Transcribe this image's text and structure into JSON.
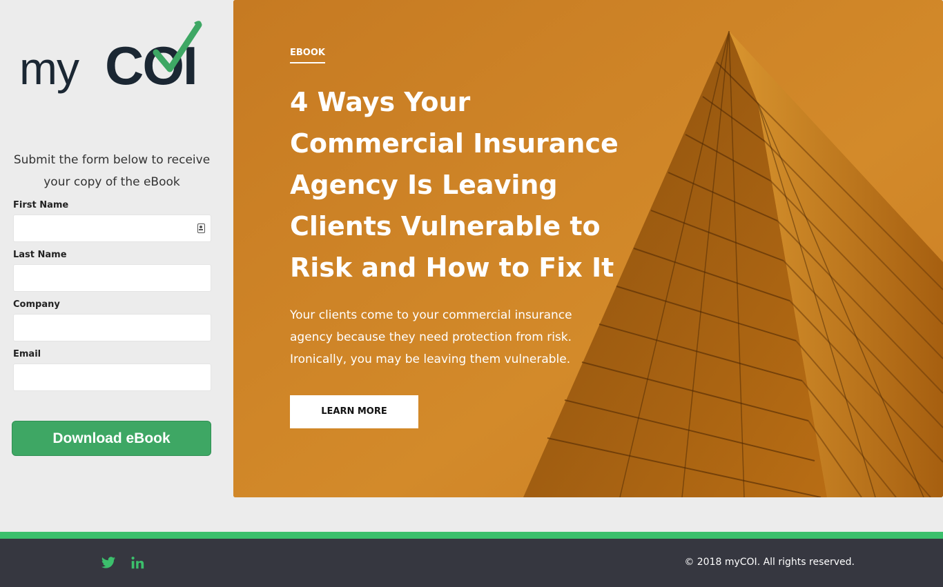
{
  "brand": {
    "logo_my": "my",
    "logo_coi": "COI",
    "colors": {
      "dark": "#1b2733",
      "check_green": "#3ea764"
    }
  },
  "form": {
    "intro": "Submit the form below to receive your copy of the eBook",
    "fields": [
      {
        "label": "First Name",
        "value": "",
        "icon": "contact-card-icon"
      },
      {
        "label": "Last Name",
        "value": ""
      },
      {
        "label": "Company",
        "value": ""
      },
      {
        "label": "Email",
        "value": ""
      }
    ],
    "submit_label": "Download eBook",
    "submit_color": "#3ea764"
  },
  "hero": {
    "eyebrow": "EBOOK",
    "title": "4 Ways Your Commercial Insurance Agency Is Leaving Clients Vulnerable to Risk and How to Fix It",
    "body": "Your clients come to your commercial insurance agency because they need protection from risk. Ironically, you may be leaving them vulnerable.",
    "cta_label": "LEARN MORE",
    "background_color": "#c87a1f"
  },
  "footer": {
    "social": [
      {
        "name": "twitter-icon"
      },
      {
        "name": "linkedin-icon"
      }
    ],
    "copyright": "© 2018 myCOI. All rights reserved.",
    "stripe_color": "#3cbf6c",
    "background_color": "#363740"
  }
}
